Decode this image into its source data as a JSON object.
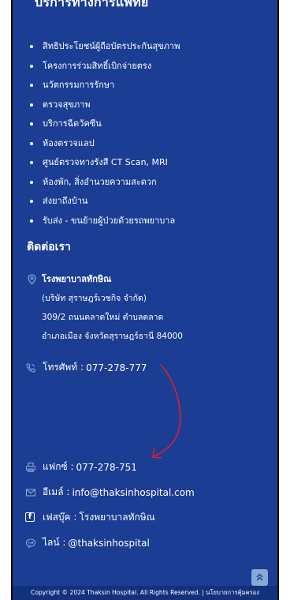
{
  "services": {
    "heading": "บริการทางการแพทย์",
    "items": [
      "สิทธิประโยชน์ผู้ถือบัตรประกันสุขภาพ",
      "โครงการร่วมสิทธิ์เบิกจ่ายตรง",
      "นวัตกรรมการรักษา",
      "ตรวจสุขภาพ",
      "บริการฉีดวัคซีน",
      "ห้องตรวจแลป",
      "ศูนย์ตรวจทางรังสี CT Scan, MRI",
      "ห้องพัก, สิ่งอำนวยความสะดวก",
      "ส่งยาถึงบ้าน",
      "รับส่ง - ขนย้ายผู้ป่วยด้วยรถพยาบาล"
    ]
  },
  "contact": {
    "heading": "ติดต่อเรา",
    "address": {
      "name": "โรงพยาบาลทักษิณ",
      "company": "(บริษัท สุราษฎร์เวชกิจ จำกัด)",
      "line1": "309/2 ถนนตลาดใหม่ ตำบลตลาด",
      "line2": "อำเภอเมือง จังหวัดสุราษฎร์ธานี 84000",
      "icon": "map-pin-icon"
    },
    "phone": {
      "label": "โทรศัพท์ :",
      "value": "077-278-777",
      "icon": "phone-icon"
    },
    "fax": {
      "label": "แฟกซ์ :",
      "value": "077-278-751",
      "icon": "fax-icon"
    },
    "email": {
      "label": "อีเมล์ :",
      "value": "info@thaksinhospital.com",
      "icon": "envelope-icon"
    },
    "facebook": {
      "label": "เฟสบุ๊ค :",
      "value": "โรงพยาบาลทักษิณ",
      "icon": "facebook-icon",
      "glyph": "f"
    },
    "line": {
      "label": "ไลน์ :",
      "value": "@thaksinhospital",
      "icon": "line-chat-icon"
    }
  },
  "scroll_top": {
    "icon": "double-chevron-up-icon"
  },
  "footer": {
    "copyright": "Copyright © 2024 Thaksin Hospital. All Rights Reserved. |",
    "policy_link": "นโยบายการคุ้มครอง"
  },
  "colors": {
    "background": "#1b3d93",
    "footer": "#13327e",
    "annotation_arrow": "#e0202b",
    "scroll_button": "#8aa8d6"
  }
}
